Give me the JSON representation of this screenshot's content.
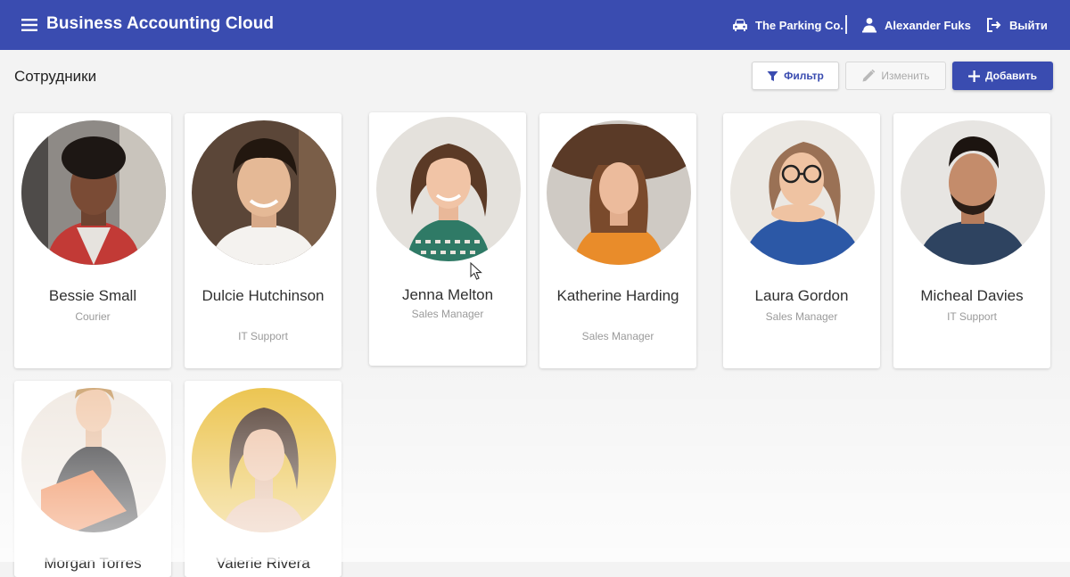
{
  "app": {
    "title": "Business Accounting Cloud"
  },
  "topbar": {
    "company": "The Parking Co.",
    "user": "Alexander Fuks",
    "logout_label": "Выйти"
  },
  "toolbar": {
    "page_title": "Сотрудники",
    "filter_label": "Фильтр",
    "edit_label": "Изменить",
    "add_label": "Добавить"
  },
  "colors": {
    "primary": "#3a4cb0",
    "background": "#f3f3f3",
    "card": "#ffffff",
    "muted_text": "#9a9a9a"
  },
  "employees": [
    {
      "name": "Bessie Small",
      "role": "Courier"
    },
    {
      "name": "Dulcie Hutchinson",
      "role": "IT Support"
    },
    {
      "name": "Jenna Melton",
      "role": "Sales Manager"
    },
    {
      "name": "Katherine Harding",
      "role": "Sales Manager"
    },
    {
      "name": "Laura Gordon",
      "role": "Sales Manager"
    },
    {
      "name": "Micheal Davies",
      "role": "IT Support"
    },
    {
      "name": "Morgan Torres",
      "role": ""
    },
    {
      "name": "Valerie Rivera",
      "role": ""
    }
  ]
}
